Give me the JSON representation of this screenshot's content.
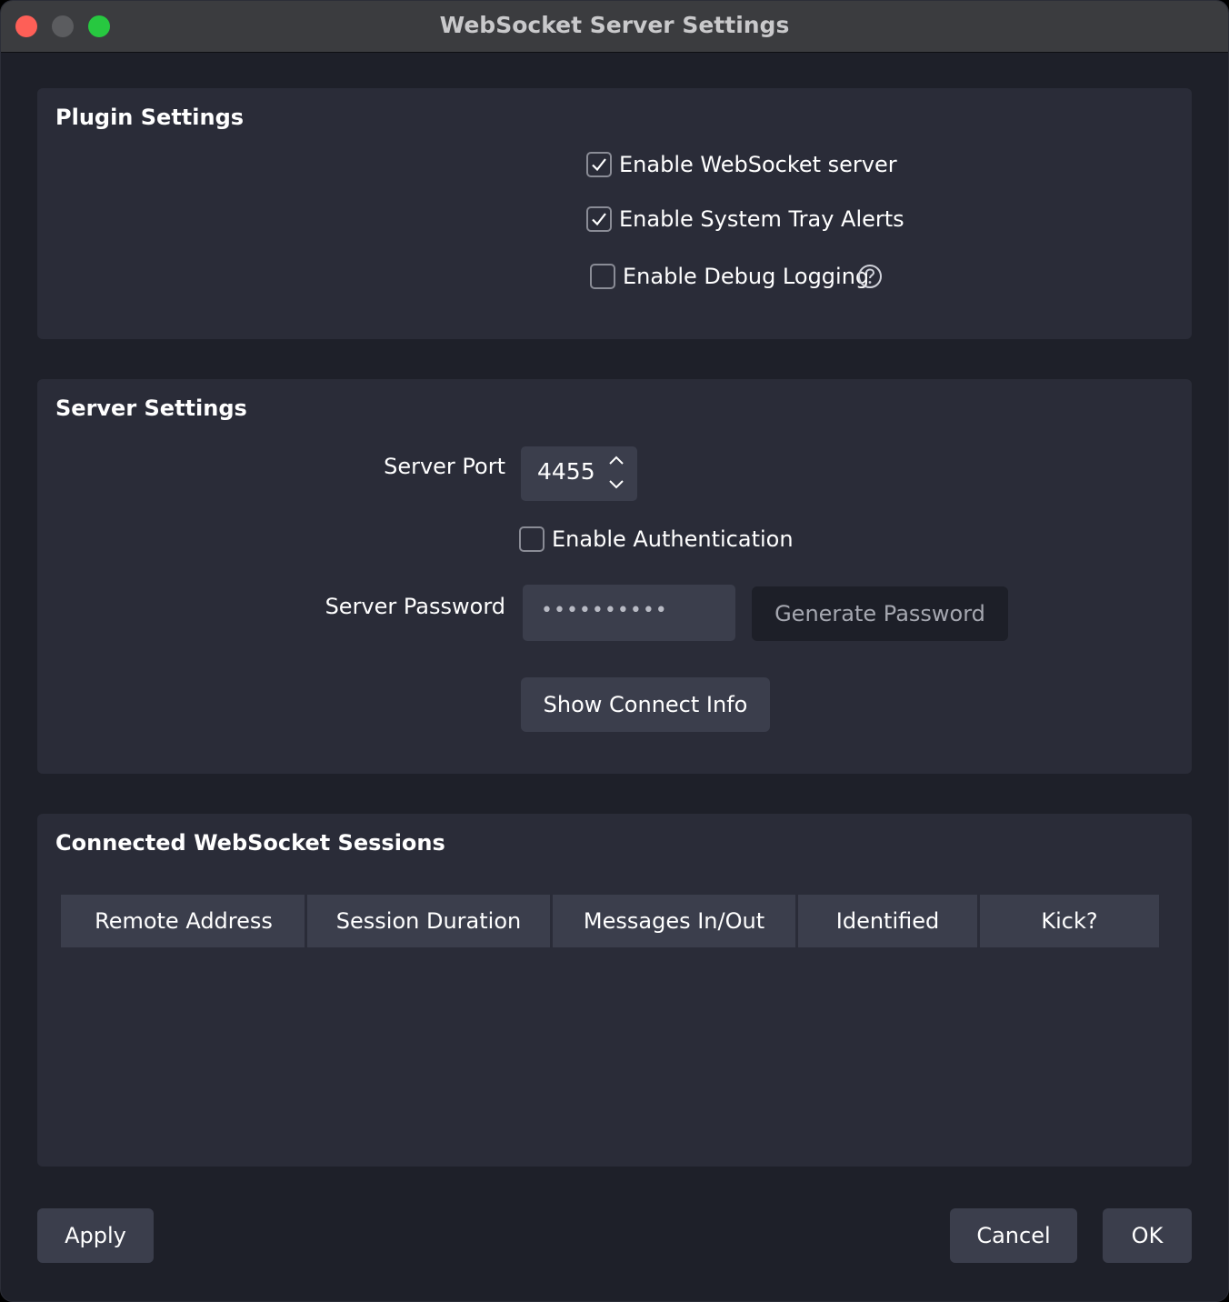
{
  "window": {
    "title": "WebSocket Server Settings"
  },
  "plugin_settings": {
    "title": "Plugin Settings",
    "enable_server": {
      "label": "Enable WebSocket server",
      "checked": true
    },
    "enable_tray_alerts": {
      "label": "Enable System Tray Alerts",
      "checked": true
    },
    "enable_debug_logging": {
      "label": "Enable Debug Logging",
      "checked": false
    }
  },
  "server_settings": {
    "title": "Server Settings",
    "port_label": "Server Port",
    "port_value": "4455",
    "enable_auth": {
      "label": "Enable Authentication",
      "checked": false
    },
    "password_label": "Server Password",
    "password_masked": "••••••••••",
    "generate_password_label": "Generate Password",
    "show_connect_info_label": "Show Connect Info"
  },
  "sessions": {
    "title": "Connected WebSocket Sessions",
    "columns": [
      "Remote Address",
      "Session Duration",
      "Messages In/Out",
      "Identified",
      "Kick?"
    ],
    "rows": []
  },
  "footer": {
    "apply_label": "Apply",
    "cancel_label": "Cancel",
    "ok_label": "OK"
  },
  "colors": {
    "window_bg": "#1e2029",
    "group_bg": "#2a2c38",
    "control_bg": "#3b3e4c",
    "close": "#fe5f57",
    "minimize": "#5b5c5f",
    "maximize": "#27c840"
  }
}
